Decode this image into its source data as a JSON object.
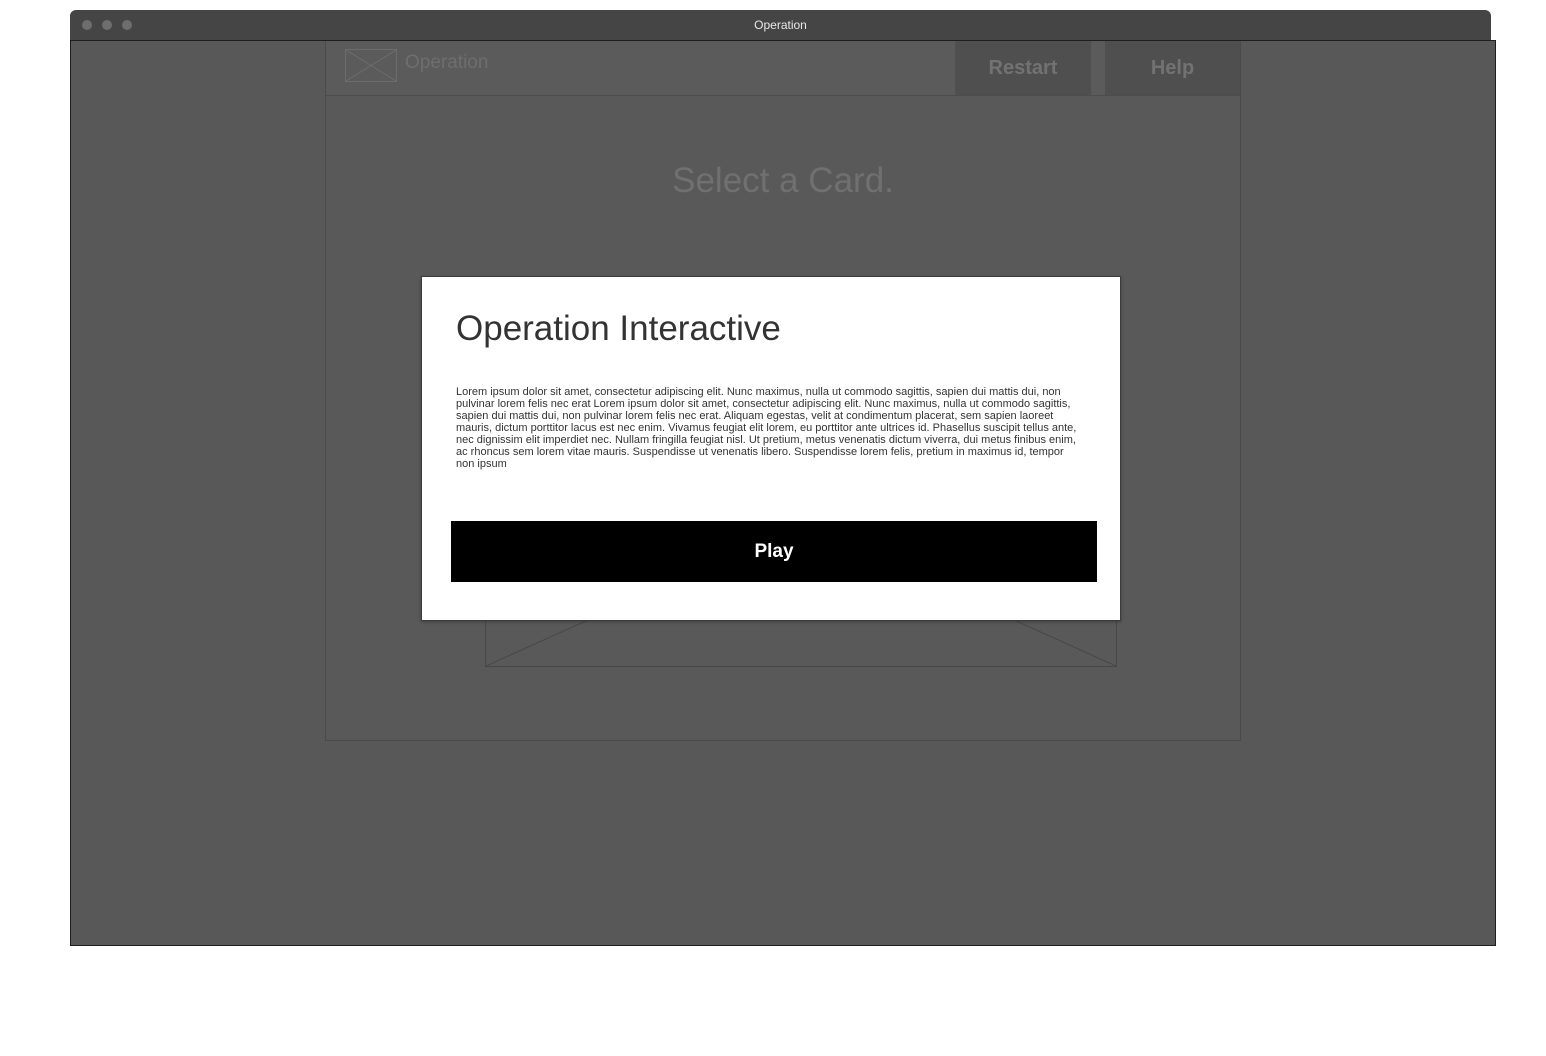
{
  "window": {
    "title": "Operation"
  },
  "app": {
    "name": "Operation",
    "logo_icon": "image-placeholder-icon",
    "buttons": {
      "restart_label": "Restart",
      "help_label": "Help"
    },
    "heading": "Select a Card.",
    "card_icon": "image-placeholder-icon"
  },
  "modal": {
    "title": "Operation Interactive",
    "body": "Lorem ipsum dolor sit amet, consectetur adipiscing elit. Nunc maximus, nulla ut commodo sagittis, sapien dui mattis dui, non pulvinar lorem felis nec erat Lorem ipsum dolor sit amet, consectetur adipiscing elit. Nunc maximus, nulla ut commodo sagittis, sapien dui mattis dui, non pulvinar lorem felis nec erat. Aliquam egestas, velit at condimentum placerat, sem sapien laoreet mauris, dictum porttitor lacus est nec enim. Vivamus feugiat elit lorem, eu porttitor ante ultrices id. Phasellus suscipit tellus ante, nec dignissim elit imperdiet nec. Nullam fringilla feugiat nisl. Ut pretium, metus venenatis dictum viverra, dui metus finibus enim, ac rhoncus sem lorem vitae mauris. Suspendisse ut venenatis libero. Suspendisse lorem felis, pretium in maximus id, tempor non ipsum",
    "play_label": "Play"
  },
  "colors": {
    "overlay": "#585858",
    "modal_background": "#ffffff",
    "play_button": "#000000",
    "titlebar": "#454545"
  }
}
